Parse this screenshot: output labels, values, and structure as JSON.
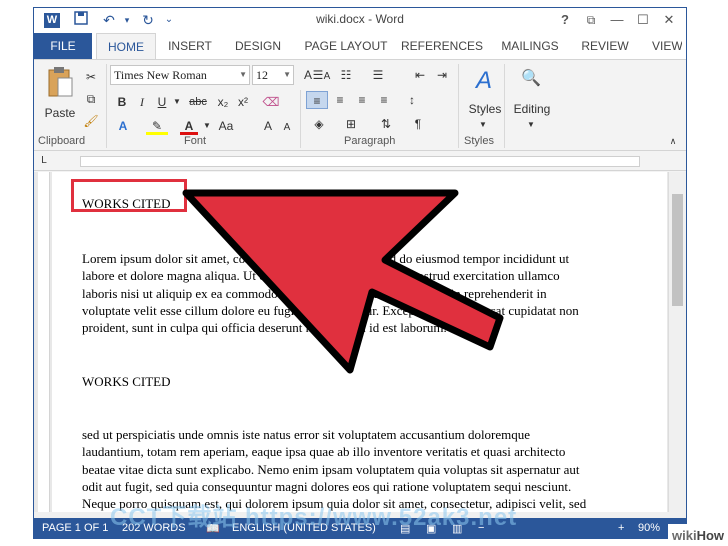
{
  "window": {
    "title": "wiki.docx - Word",
    "logo": "W"
  },
  "quick_access": {
    "save_icon": "save-icon",
    "undo_icon": "undo-icon",
    "redo_icon": "redo-icon"
  },
  "window_controls": {
    "help": "?",
    "restore": "⧉",
    "minimize": "—",
    "maximize": "☐",
    "close": "✕"
  },
  "tabs": [
    "FILE",
    "HOME",
    "INSERT",
    "DESIGN",
    "PAGE LAYOUT",
    "REFERENCES",
    "MAILINGS",
    "REVIEW",
    "VIEW"
  ],
  "ribbon": {
    "clipboard": {
      "paste_label": "Paste",
      "group_label": "Clipboard"
    },
    "font": {
      "font_name": "Times New Roman",
      "font_size": "12",
      "group_label": "Font",
      "buttons": {
        "bold": "B",
        "italic": "I",
        "underline": "U",
        "strike": "abc",
        "subscript": "x₂",
        "superscript": "x²",
        "grow": "A",
        "shrink": "A",
        "case": "Aa",
        "font_color": "A",
        "text_effects": "A"
      }
    },
    "paragraph": {
      "group_label": "Paragraph",
      "pilcrow": "¶"
    },
    "styles": {
      "label": "Styles",
      "group_label": "Styles"
    },
    "editing": {
      "label": "Editing"
    }
  },
  "document": {
    "heading_1": "WORKS CITED",
    "paragraph_1": "Lorem ipsum dolor sit amet, consectetur adipisicing elit, sed do eiusmod tempor incididunt ut\nlabore et dolore magna aliqua. Ut enim ad minim veniam, quis nostrud exercitation ullamco\nlaboris nisi ut aliquip ex ea commodo consequat. Duis aute irure dolor in reprehenderit in\nvoluptate velit esse cillum dolore eu fugiat nulla pariatur. Excepteur sint occaecat cupidatat non\nproident, sunt in culpa qui officia deserunt mollit anim id est laborum.",
    "heading_2": "WORKS CITED",
    "paragraph_2": "sed ut perspiciatis unde omnis iste natus error sit voluptatem accusantium doloremque\nlaudantium, totam rem aperiam, eaque ipsa quae ab illo inventore veritatis et quasi architecto\nbeatae vitae dicta sunt explicabo. Nemo enim ipsam voluptatem quia voluptas sit aspernatur aut\nodit aut fugit, sed quia consequuntur magni dolores eos qui ratione voluptatem sequi nesciunt.\nNeque porro quisquam est, qui dolorem ipsum quia dolor sit amet, consectetur, adipisci velit, sed"
  },
  "status": {
    "page": "PAGE 1 OF 1",
    "words": "202 WORDS",
    "language": "ENGLISH (UNITED STATES)",
    "zoom": "90%"
  },
  "colors": {
    "accent": "#2b579a",
    "callout": "#e0303e"
  },
  "overlay": {
    "watermark": "CCT下载站 https://www.52ak3.net",
    "brand": "wikiHow"
  }
}
